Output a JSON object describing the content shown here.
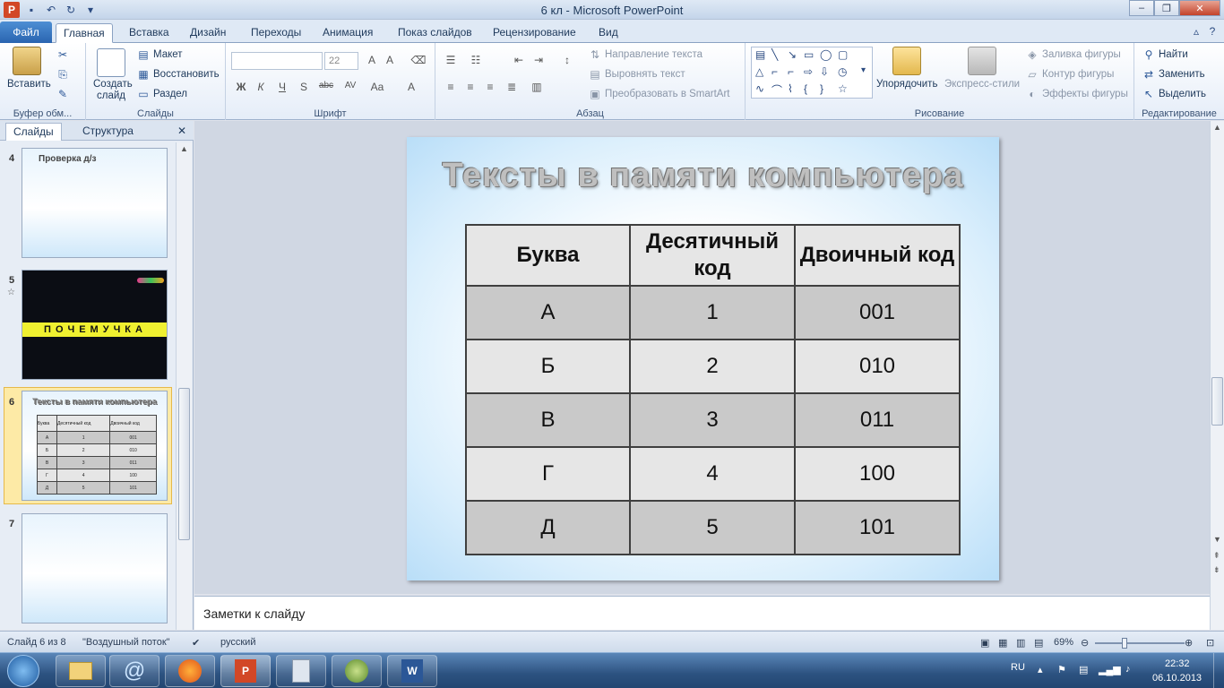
{
  "window": {
    "title": "6 кл  -  Microsoft PowerPoint",
    "app_icon": "P",
    "buttons": {
      "minimize": "–",
      "maximize": "❐",
      "close": "✕"
    }
  },
  "ribbon_tabs": {
    "file": "Файл",
    "items": [
      "Главная",
      "Вставка",
      "Дизайн",
      "Переходы",
      "Анимация",
      "Показ слайдов",
      "Рецензирование",
      "Вид"
    ]
  },
  "ribbon": {
    "clipboard": {
      "label": "Буфер обм...",
      "paste": "Вставить"
    },
    "slides": {
      "label": "Слайды",
      "new_slide_1": "Создать",
      "new_slide_2": "слайд",
      "layout": "Макет",
      "reset": "Восстановить",
      "section": "Раздел"
    },
    "font": {
      "label": "Шрифт",
      "size": "22",
      "bold": "Ж",
      "italic": "К",
      "underline": "Ч",
      "shadow": "S",
      "strike": "abc",
      "spacing": "AV",
      "case": "Aa",
      "color": "A"
    },
    "paragraph": {
      "label": "Абзац",
      "text_direction": "Направление текста",
      "align_text": "Выровнять текст",
      "smartart": "Преобразовать в SmartArt"
    },
    "drawing": {
      "label": "Рисование",
      "arrange": "Упорядочить",
      "quick_styles": "Экспресс-стили",
      "fill": "Заливка фигуры",
      "outline": "Контур фигуры",
      "effects": "Эффекты фигуры"
    },
    "editing": {
      "label": "Редактирование",
      "find": "Найти",
      "replace": "Заменить",
      "select": "Выделить"
    }
  },
  "left_panel": {
    "tabs": [
      "Слайды",
      "Структура"
    ],
    "close": "✕",
    "thumbnails": [
      {
        "number": "4",
        "title": "Проверка д/з"
      },
      {
        "number": "5",
        "title": "ПОЧЕМУЧКА"
      },
      {
        "number": "6",
        "title": "Тексты в памяти компьютера"
      },
      {
        "number": "7",
        "title": ""
      }
    ]
  },
  "slide": {
    "title": "Тексты в памяти компьютера",
    "table": {
      "headers": [
        "Буква",
        "Десятичный код",
        "Двоичный код"
      ],
      "rows": [
        [
          "А",
          "1",
          "001"
        ],
        [
          "Б",
          "2",
          "010"
        ],
        [
          "В",
          "3",
          "011"
        ],
        [
          "Г",
          "4",
          "100"
        ],
        [
          "Д",
          "5",
          "101"
        ]
      ]
    }
  },
  "notes": {
    "placeholder": "Заметки к слайду"
  },
  "status_bar": {
    "slide_info": "Слайд 6 из 8",
    "theme": "\"Воздушный поток\"",
    "language": "русский",
    "zoom": "69%"
  },
  "taskbar": {
    "lang": "RU",
    "time": "22:32",
    "date": "06.10.2013"
  },
  "colors": {
    "file_tab": "#2a64b0",
    "selected_thumb": "#f2c74a",
    "taskbar": "#2c5280"
  }
}
